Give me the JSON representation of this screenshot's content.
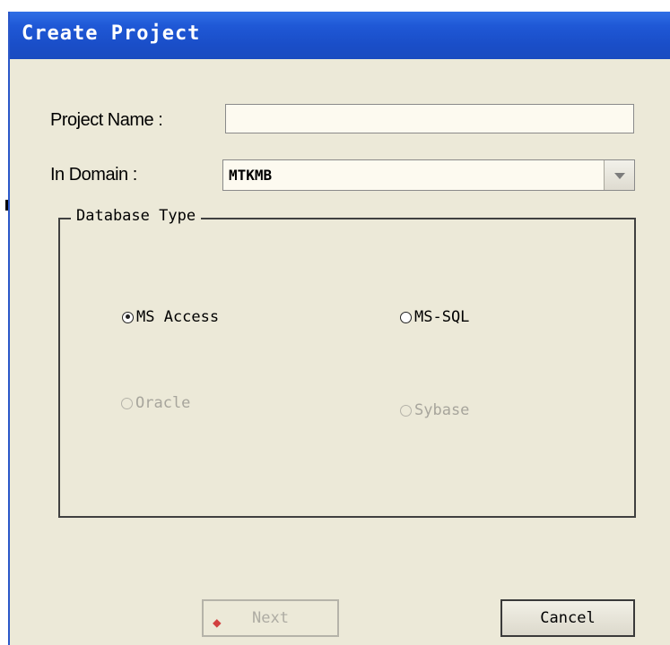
{
  "dialog": {
    "title": "Create Project",
    "project_name_label": "Project Name :",
    "project_name_value": "",
    "domain_label": "In Domain :",
    "domain_value": "MTKMB",
    "database_group_label": "Database Type",
    "options": [
      {
        "label": "MS Access",
        "selected": true,
        "enabled": true
      },
      {
        "label": "MS-SQL",
        "selected": false,
        "enabled": true
      },
      {
        "label": "Oracle",
        "selected": false,
        "enabled": false
      },
      {
        "label": "Sybase",
        "selected": false,
        "enabled": false
      }
    ],
    "next_label": "Next",
    "cancel_label": "Cancel",
    "next_icon": "wizard-next-icon"
  }
}
